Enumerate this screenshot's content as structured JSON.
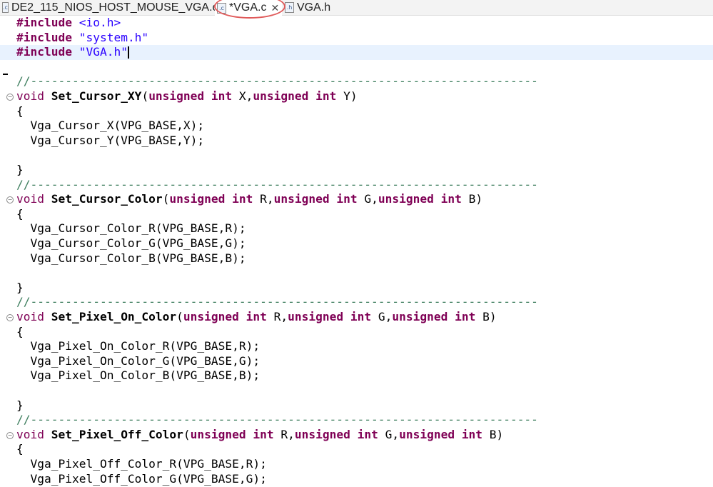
{
  "tabs": [
    {
      "label": "DE2_115_NIOS_HOST_MOUSE_VGA.c",
      "icon": "c-file-icon",
      "active": false
    },
    {
      "label": "*VGA.c",
      "icon": "c-file-icon",
      "active": true,
      "close": "✕"
    },
    {
      "label": "VGA.h",
      "icon": "h-file-icon",
      "active": false
    }
  ],
  "colors": {
    "keyword": "#7f0055",
    "string": "#2a00ff",
    "comment": "#3f7f5f",
    "highlight": "#e8f2fe",
    "annotation": "#e05a5a"
  },
  "code_lines": [
    [
      [
        "kw",
        "#include"
      ],
      [
        "pl",
        " "
      ],
      [
        "str",
        "<io.h>"
      ]
    ],
    [
      [
        "kw",
        "#include"
      ],
      [
        "pl",
        " "
      ],
      [
        "str",
        "\"system.h\""
      ]
    ],
    [
      [
        "kw",
        "#include"
      ],
      [
        "pl",
        " "
      ],
      [
        "str",
        "\"VGA.h\""
      ]
    ],
    [],
    [
      [
        "cm",
        "//-------------------------------------------------------------------------"
      ]
    ],
    [
      [
        "kw2",
        "void"
      ],
      [
        "pl",
        " "
      ],
      [
        "fn",
        "Set_Cursor_XY"
      ],
      [
        "pl",
        "("
      ],
      [
        "kw",
        "unsigned"
      ],
      [
        "pl",
        " "
      ],
      [
        "kw",
        "int"
      ],
      [
        "pl",
        " X,"
      ],
      [
        "kw",
        "unsigned"
      ],
      [
        "pl",
        " "
      ],
      [
        "kw",
        "int"
      ],
      [
        "pl",
        " Y)"
      ]
    ],
    [
      [
        "pl",
        "{"
      ]
    ],
    [
      [
        "pl",
        "  Vga_Cursor_X(VPG_BASE,X);"
      ]
    ],
    [
      [
        "pl",
        "  Vga_Cursor_Y(VPG_BASE,Y);"
      ]
    ],
    [],
    [
      [
        "pl",
        "}"
      ]
    ],
    [
      [
        "cm",
        "//-------------------------------------------------------------------------"
      ]
    ],
    [
      [
        "kw2",
        "void"
      ],
      [
        "pl",
        " "
      ],
      [
        "fn",
        "Set_Cursor_Color"
      ],
      [
        "pl",
        "("
      ],
      [
        "kw",
        "unsigned"
      ],
      [
        "pl",
        " "
      ],
      [
        "kw",
        "int"
      ],
      [
        "pl",
        " R,"
      ],
      [
        "kw",
        "unsigned"
      ],
      [
        "pl",
        " "
      ],
      [
        "kw",
        "int"
      ],
      [
        "pl",
        " G,"
      ],
      [
        "kw",
        "unsigned"
      ],
      [
        "pl",
        " "
      ],
      [
        "kw",
        "int"
      ],
      [
        "pl",
        " B)"
      ]
    ],
    [
      [
        "pl",
        "{"
      ]
    ],
    [
      [
        "pl",
        "  Vga_Cursor_Color_R(VPG_BASE,R);"
      ]
    ],
    [
      [
        "pl",
        "  Vga_Cursor_Color_G(VPG_BASE,G);"
      ]
    ],
    [
      [
        "pl",
        "  Vga_Cursor_Color_B(VPG_BASE,B);"
      ]
    ],
    [],
    [
      [
        "pl",
        "}"
      ]
    ],
    [
      [
        "cm",
        "//-------------------------------------------------------------------------"
      ]
    ],
    [
      [
        "kw2",
        "void"
      ],
      [
        "pl",
        " "
      ],
      [
        "fn",
        "Set_Pixel_On_Color"
      ],
      [
        "pl",
        "("
      ],
      [
        "kw",
        "unsigned"
      ],
      [
        "pl",
        " "
      ],
      [
        "kw",
        "int"
      ],
      [
        "pl",
        " R,"
      ],
      [
        "kw",
        "unsigned"
      ],
      [
        "pl",
        " "
      ],
      [
        "kw",
        "int"
      ],
      [
        "pl",
        " G,"
      ],
      [
        "kw",
        "unsigned"
      ],
      [
        "pl",
        " "
      ],
      [
        "kw",
        "int"
      ],
      [
        "pl",
        " B)"
      ]
    ],
    [
      [
        "pl",
        "{"
      ]
    ],
    [
      [
        "pl",
        "  Vga_Pixel_On_Color_R(VPG_BASE,R);"
      ]
    ],
    [
      [
        "pl",
        "  Vga_Pixel_On_Color_G(VPG_BASE,G);"
      ]
    ],
    [
      [
        "pl",
        "  Vga_Pixel_On_Color_B(VPG_BASE,B);"
      ]
    ],
    [],
    [
      [
        "pl",
        "}"
      ]
    ],
    [
      [
        "cm",
        "//-------------------------------------------------------------------------"
      ]
    ],
    [
      [
        "kw2",
        "void"
      ],
      [
        "pl",
        " "
      ],
      [
        "fn",
        "Set_Pixel_Off_Color"
      ],
      [
        "pl",
        "("
      ],
      [
        "kw",
        "unsigned"
      ],
      [
        "pl",
        " "
      ],
      [
        "kw",
        "int"
      ],
      [
        "pl",
        " R,"
      ],
      [
        "kw",
        "unsigned"
      ],
      [
        "pl",
        " "
      ],
      [
        "kw",
        "int"
      ],
      [
        "pl",
        " G,"
      ],
      [
        "kw",
        "unsigned"
      ],
      [
        "pl",
        " "
      ],
      [
        "kw",
        "int"
      ],
      [
        "pl",
        " B)"
      ]
    ],
    [
      [
        "pl",
        "{"
      ]
    ],
    [
      [
        "pl",
        "  Vga_Pixel_Off_Color_R(VPG_BASE,R);"
      ]
    ],
    [
      [
        "pl",
        "  Vga_Pixel_Off_Color_G(VPG_BASE,G);"
      ]
    ]
  ],
  "editor": {
    "highlighted_line": 2,
    "fold_lines": [
      5,
      12,
      20,
      28
    ]
  }
}
